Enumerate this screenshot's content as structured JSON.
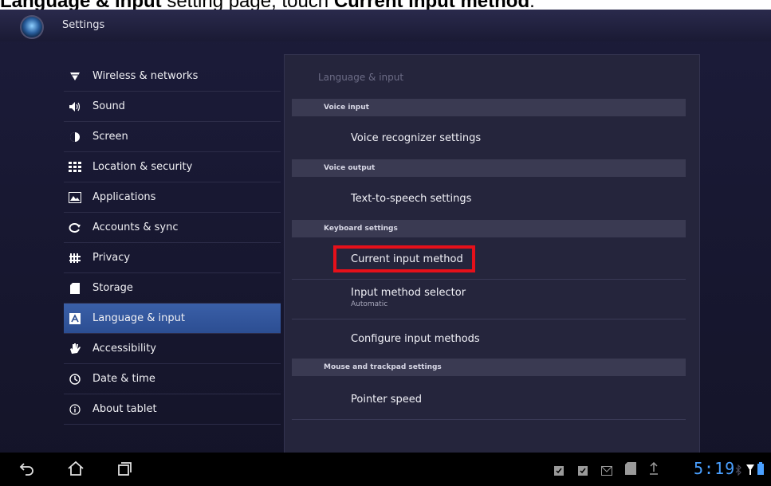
{
  "caption": {
    "part1": "Language & input",
    "part2": " setting page, touch ",
    "part3": "Current input method",
    "part4": "."
  },
  "app": {
    "title": "Settings"
  },
  "nav": {
    "items": [
      {
        "label": "Wireless & networks",
        "icon": "wifi-icon"
      },
      {
        "label": "Sound",
        "icon": "speaker-icon"
      },
      {
        "label": "Screen",
        "icon": "screen-icon"
      },
      {
        "label": "Location & security",
        "icon": "location-security-icon"
      },
      {
        "label": "Applications",
        "icon": "applications-icon"
      },
      {
        "label": "Accounts & sync",
        "icon": "sync-icon"
      },
      {
        "label": "Privacy",
        "icon": "privacy-icon"
      },
      {
        "label": "Storage",
        "icon": "storage-icon"
      },
      {
        "label": "Language & input",
        "icon": "language-icon",
        "active": true
      },
      {
        "label": "Accessibility",
        "icon": "hand-icon"
      },
      {
        "label": "Date & time",
        "icon": "clock-icon"
      },
      {
        "label": "About tablet",
        "icon": "info-icon"
      }
    ]
  },
  "panel": {
    "title": "Language & input",
    "sections": {
      "voice_input": "Voice input",
      "voice_output": "Voice output",
      "keyboard": "Keyboard settings",
      "mouse": "Mouse and trackpad settings"
    },
    "rows": {
      "voice_recognizer": "Voice recognizer settings",
      "tts": "Text-to-speech settings",
      "current_input": "Current input method",
      "input_selector": "Input method selector",
      "input_selector_sub": "Automatic",
      "configure": "Configure input methods",
      "pointer_speed": "Pointer speed"
    }
  },
  "statusbar": {
    "time": "5:19"
  },
  "colors": {
    "accent": "#2c4e92",
    "highlight": "#e6101a",
    "clock": "#4aa0ff"
  }
}
